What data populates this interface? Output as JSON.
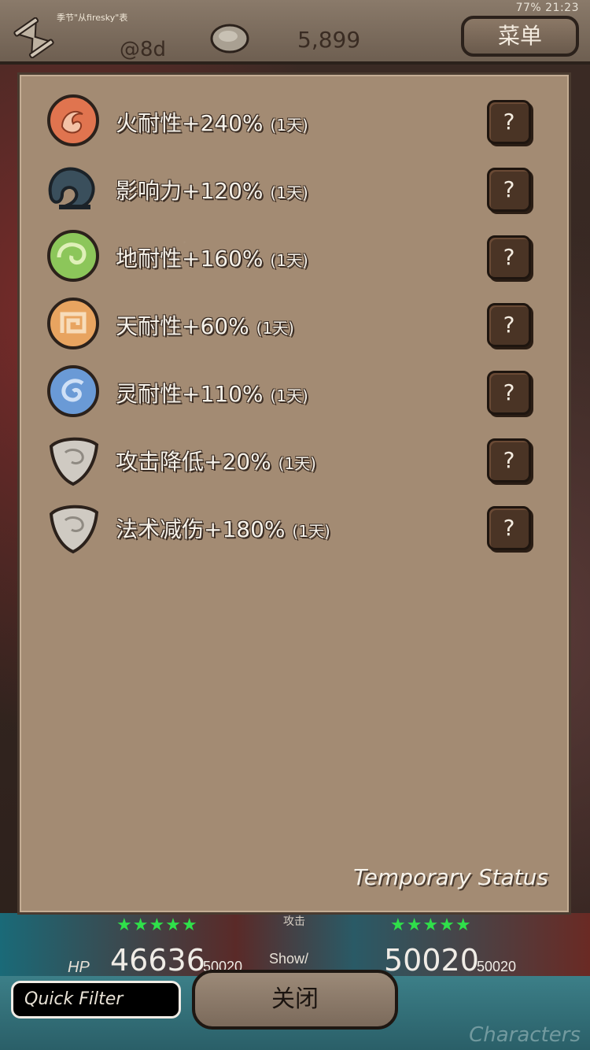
{
  "status_bar": {
    "battery": "77%",
    "time": "21:23"
  },
  "header": {
    "season_label": "季节\"从firesky\"表",
    "timer": "@8d",
    "coins": "5,899",
    "menu_label": "菜单"
  },
  "panel": {
    "title": "Temporary Status",
    "items": [
      {
        "label": "火耐性+240%",
        "duration": "(1天)",
        "icon": "fire-orb-icon",
        "color": "#e0744f",
        "help": "?"
      },
      {
        "label": "影响力+120%",
        "duration": "(1天)",
        "icon": "shadow-swirl-icon",
        "color": "#3a4f5c",
        "help": "?"
      },
      {
        "label": "地耐性+160%",
        "duration": "(1天)",
        "icon": "earth-orb-icon",
        "color": "#8cc65a",
        "help": "?"
      },
      {
        "label": "天耐性+60%",
        "duration": "(1天)",
        "icon": "sky-orb-icon",
        "color": "#e8a460",
        "help": "?"
      },
      {
        "label": "灵耐性+110%",
        "duration": "(1天)",
        "icon": "spirit-orb-icon",
        "color": "#6a9ad6",
        "help": "?"
      },
      {
        "label": "攻击降低+20%",
        "duration": "(1天)",
        "icon": "stone-shield-icon",
        "color": "#cfcac2",
        "help": "?"
      },
      {
        "label": "法术减伤+180%",
        "duration": "(1天)",
        "icon": "stone-shield-icon",
        "color": "#cfcac2",
        "help": "?"
      }
    ]
  },
  "team": {
    "stars_left": "★★★★★",
    "stars_right": "★★★★★",
    "hp_label": "HP",
    "hp_left": "46636",
    "hp_left_max": "50020",
    "show_label": "Show/",
    "attack_label": "攻击",
    "hp_right": "50020",
    "hp_right_max": "50020"
  },
  "footer": {
    "quick_filter_placeholder": "Quick Filter",
    "close_label": "关闭",
    "characters_label": "Characters"
  }
}
